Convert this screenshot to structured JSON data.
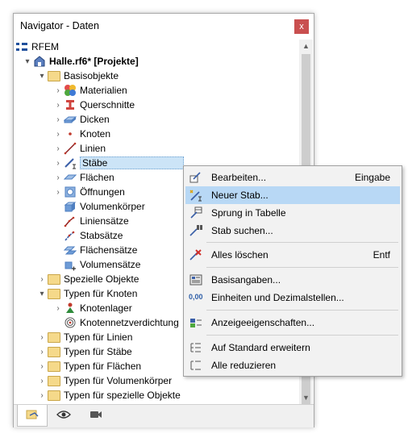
{
  "panel": {
    "title": "Navigator - Daten",
    "close_label": "x"
  },
  "tree": [
    {
      "label": "RFEM",
      "expander": "",
      "icon": "rfem-icon"
    },
    {
      "label": "Halle.rf6* [Projekte]",
      "expander": "▾",
      "icon": "model-icon"
    },
    {
      "label": "Basisobjekte",
      "expander": "▾",
      "icon": "folder-icon"
    },
    {
      "label": "Materialien",
      "expander": "›",
      "icon": "materials-icon"
    },
    {
      "label": "Querschnitte",
      "expander": "›",
      "icon": "cross-section-icon"
    },
    {
      "label": "Dicken",
      "expander": "›",
      "icon": "thickness-icon"
    },
    {
      "label": "Knoten",
      "expander": "›",
      "icon": "node-icon"
    },
    {
      "label": "Linien",
      "expander": "›",
      "icon": "line-icon"
    },
    {
      "label": "Stäbe",
      "expander": "›",
      "icon": "member-icon"
    },
    {
      "label": "Flächen",
      "expander": "›",
      "icon": "surface-icon"
    },
    {
      "label": "Öffnungen",
      "expander": "›",
      "icon": "opening-icon"
    },
    {
      "label": "Volumenkörper",
      "expander": "",
      "icon": "solid-icon"
    },
    {
      "label": "Liniensätze",
      "expander": "",
      "icon": "line-set-icon"
    },
    {
      "label": "Stabsätze",
      "expander": "",
      "icon": "member-set-icon"
    },
    {
      "label": "Flächensätze",
      "expander": "",
      "icon": "surface-set-icon"
    },
    {
      "label": "Volumensätze",
      "expander": "",
      "icon": "solid-set-icon"
    },
    {
      "label": "Spezielle Objekte",
      "expander": "›",
      "icon": "folder-icon"
    },
    {
      "label": "Typen für Knoten",
      "expander": "▾",
      "icon": "folder-icon"
    },
    {
      "label": "Knotenlager",
      "expander": "›",
      "icon": "nodal-support-icon"
    },
    {
      "label": "Knotennetzverdichtung",
      "expander": "",
      "icon": "mesh-refinement-icon"
    },
    {
      "label": "Typen für Linien",
      "expander": "›",
      "icon": "folder-icon"
    },
    {
      "label": "Typen für Stäbe",
      "expander": "›",
      "icon": "folder-icon"
    },
    {
      "label": "Typen für Flächen",
      "expander": "›",
      "icon": "folder-icon"
    },
    {
      "label": "Typen für Volumenkörper",
      "expander": "›",
      "icon": "folder-icon"
    },
    {
      "label": "Typen für spezielle Objekte",
      "expander": "›",
      "icon": "folder-icon"
    }
  ],
  "scrollbar": {
    "up": "▲",
    "down": "▼"
  },
  "tabs": [
    {
      "icon": "data-tab-icon",
      "active": true
    },
    {
      "icon": "view-eye-icon",
      "active": false
    },
    {
      "icon": "video-camera-icon",
      "active": false
    }
  ],
  "context_menu": {
    "items": [
      {
        "label": "Bearbeiten...",
        "shortcut": "Eingabe",
        "icon": "edit-icon"
      },
      {
        "label": "Neuer Stab...",
        "shortcut": "",
        "icon": "new-member-icon",
        "highlighted": true
      },
      {
        "label": "Sprung in Tabelle",
        "shortcut": "",
        "icon": "jump-table-icon"
      },
      {
        "label": "Stab suchen...",
        "shortcut": "",
        "icon": "find-member-icon"
      },
      {
        "label": "Alles löschen",
        "shortcut": "Entf",
        "icon": "delete-all-icon"
      },
      {
        "label": "Basisangaben...",
        "shortcut": "",
        "icon": "base-data-icon"
      },
      {
        "label": "Einheiten und Dezimalstellen...",
        "shortcut": "",
        "icon": "units-icon"
      },
      {
        "label": "Anzeigeeigenschaften...",
        "shortcut": "",
        "icon": "display-properties-icon"
      },
      {
        "label": "Auf Standard erweitern",
        "shortcut": "",
        "icon": "expand-default-icon"
      },
      {
        "label": "Alle reduzieren",
        "shortcut": "",
        "icon": "collapse-all-icon"
      }
    ],
    "units_icon_text": "0,00"
  }
}
